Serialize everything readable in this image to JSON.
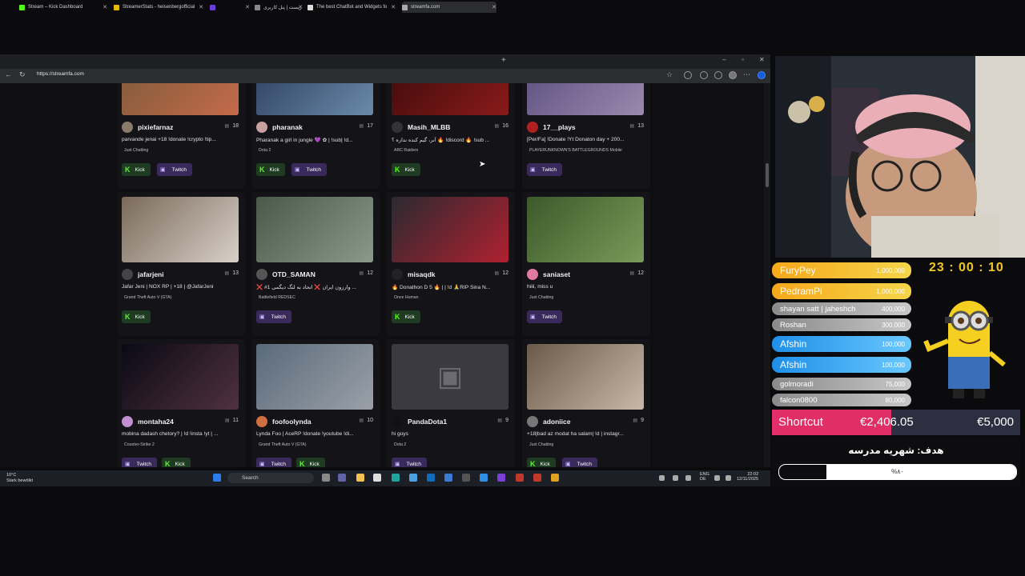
{
  "browser": {
    "tabs": [
      {
        "label": "Stream – Kick Dashboard",
        "color": "#53fc18"
      },
      {
        "label": "StreamerStats - heisenbergofficial",
        "color": "#e6b800"
      },
      {
        "label": "",
        "color": "#6a3fd9"
      },
      {
        "label": "زیست | پنل کاربری",
        "color": "#888888"
      },
      {
        "label": "The best ChatBot and Widgets fo",
        "color": "#dddddd"
      },
      {
        "label": "streamfa.com",
        "color": "#aaaaaa"
      }
    ],
    "url": "https://streamfa.com"
  },
  "streams": [
    {
      "name": "pixiefarnaz",
      "viewers": "18",
      "title": "parvande jenai +18 !donate !crypto !tip...",
      "category": "Just Chatting",
      "buttons": [
        "Kick",
        "Twitch"
      ],
      "avatar": "#8a7a6a"
    },
    {
      "name": "pharanak",
      "viewers": "17",
      "title": "Pharanak a girl in jungle 💜 ✿ | !sub| !d...",
      "category": "Dota 2",
      "buttons": [
        "Kick",
        "Twitch"
      ],
      "avatar": "#c9a0a0"
    },
    {
      "name": "Masih_MLBB",
      "viewers": "16",
      "title": "آنر، گیم کنده نداره ؟ 🔥 !discord 🔥 !sub ...",
      "category": "ARC Raiders",
      "buttons": [
        "Kick"
      ],
      "avatar": "#333333"
    },
    {
      "name": "17__plays",
      "viewers": "13",
      "title": "[Per/Fa] !Donate !Yt Donaton day + 200...",
      "category": "PLAYERUNKNOWN'S BATTLEGROUNDS Mobile",
      "buttons": [
        "Twitch"
      ],
      "avatar": "#b02020"
    },
    {
      "name": "jafarjeni",
      "viewers": "13",
      "title": "Jafar Jeni | NOX RP | +18 | @JafarJeni",
      "category": "Grand Theft Auto V (GTA)",
      "buttons": [
        "Kick"
      ],
      "avatar": "#444444"
    },
    {
      "name": "OTD_SAMAN",
      "viewers": "12",
      "title": "❌ #1 وارزون ایران ❌ اتحاد به لنگ دیگمی ...",
      "category": "Battlefield REDSEC",
      "buttons": [
        "Twitch"
      ],
      "avatar": "#555555"
    },
    {
      "name": "misaqdk",
      "viewers": "12",
      "title": "🔥 Donathon D 5 🔥 | | !d 🙏RIP Sina N...",
      "category": "Once Human",
      "buttons": [
        "Kick"
      ],
      "avatar": "#222222"
    },
    {
      "name": "saniaset",
      "viewers": "12",
      "title": "hiiii, miss u",
      "category": "Just Chatting",
      "buttons": [
        "Twitch"
      ],
      "avatar": "#e07aa0"
    },
    {
      "name": "montaha24",
      "viewers": "11",
      "title": "mobina dadash chetory? | !d !insta !yt | ...",
      "category": "Counter-Strike 2",
      "buttons": [
        "Twitch",
        "Kick"
      ],
      "avatar": "#c090d0"
    },
    {
      "name": "foofoolynda",
      "viewers": "10",
      "title": "Lynda Foo | AceRP !donate !youtube !di...",
      "category": "Grand Theft Auto V (GTA)",
      "buttons": [
        "Twitch",
        "Kick"
      ],
      "avatar": "#d07040"
    },
    {
      "name": "PandaDota1",
      "viewers": "9",
      "title": "hi guys",
      "category": "Dota 2",
      "buttons": [
        "Twitch"
      ],
      "avatar": "#111111"
    },
    {
      "name": "adoniice",
      "viewers": "9",
      "title": "+18|bad az modat ha salam| !d | instagr...",
      "category": "Just Chatting",
      "buttons": [
        "Kick",
        "Twitch"
      ],
      "avatar": "#777777"
    }
  ],
  "taskbar": {
    "weather_temp": "10°C",
    "weather_desc": "Stark bewölkt",
    "search": "Search",
    "lang1": "ENG",
    "lang2": "DE",
    "time": "22:02",
    "date": "12/11/2025"
  },
  "overlay": {
    "donors": [
      {
        "name": "FuryPey",
        "amount": "1,000,000"
      },
      {
        "name": "PedramPi",
        "amount": "1,000,000"
      },
      {
        "name": "shayan satt | jaheshch",
        "amount": "400,000"
      },
      {
        "name": "Roshan",
        "amount": "300,000"
      },
      {
        "name": "Afshin",
        "amount": "100,000"
      },
      {
        "name": "Afshin",
        "amount": "100,000"
      },
      {
        "name": "golmoradi",
        "amount": "75,000"
      },
      {
        "name": "falcon0800",
        "amount": "80,000"
      }
    ],
    "timer": "23 : 00 : 10",
    "shortcut_label": "Shortcut",
    "shortcut_current": "€2,406.05",
    "shortcut_goal": "€5,000",
    "shortcut_progress": 0.48,
    "goal_title": "هدف: شهریه مدرسه",
    "goal_percent_label": "%۸۰",
    "goal_progress": 0.8
  }
}
